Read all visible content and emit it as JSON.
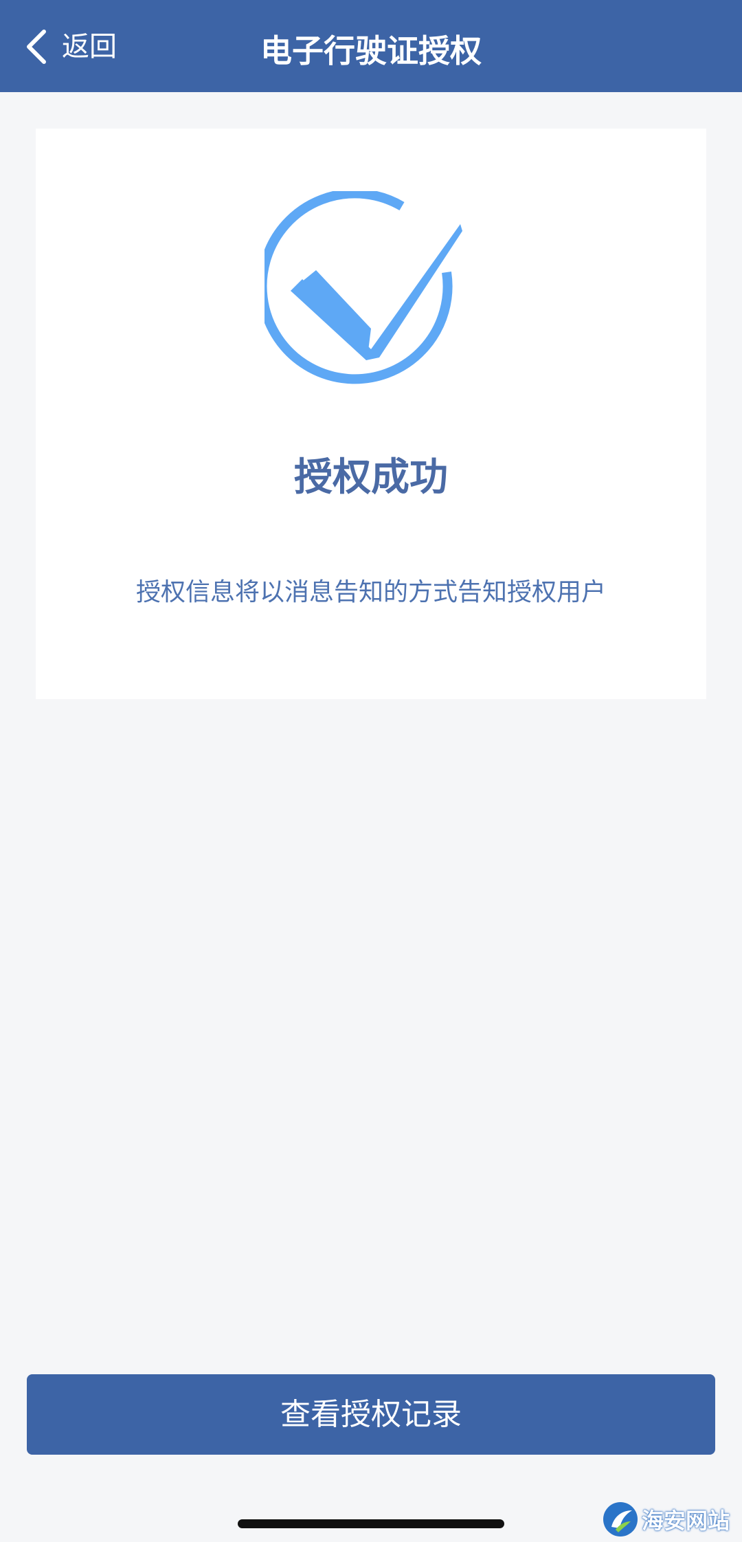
{
  "nav": {
    "back_label": "返回",
    "title": "电子行驶证授权"
  },
  "result": {
    "icon": "check-circle-icon",
    "title": "授权成功",
    "description": "授权信息将以消息告知的方式告知授权用户"
  },
  "actions": {
    "view_records_label": "查看授权记录"
  },
  "watermark": {
    "text": "海安网站"
  },
  "colors": {
    "primary": "#3d64a6",
    "icon_blue": "#5ea8f5",
    "title_blue": "#4a6aa5",
    "desc_blue": "#4d72b0",
    "background": "#f5f6f8"
  }
}
